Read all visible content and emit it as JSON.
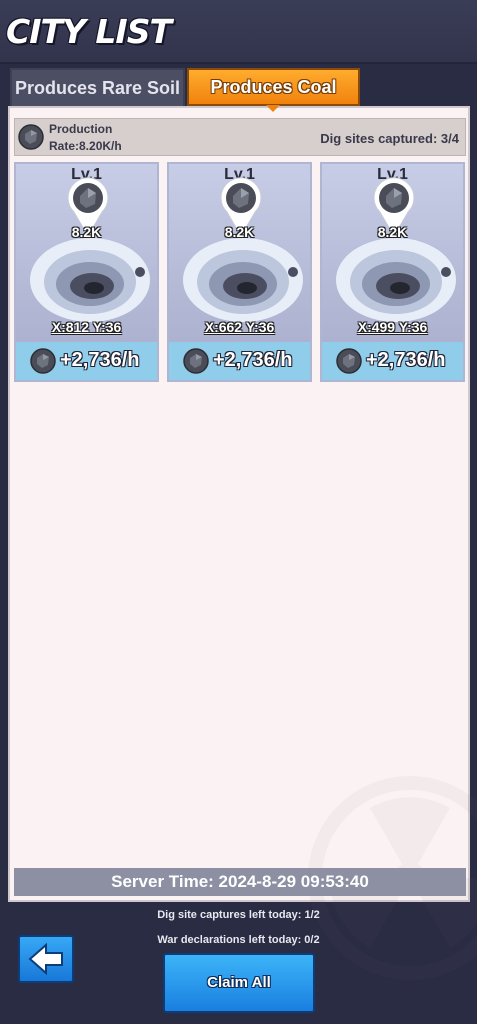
{
  "header": {
    "title": "CITY LIST"
  },
  "tabs": [
    {
      "label": "Produces Rare Soil",
      "active": false
    },
    {
      "label": "Produces Coal",
      "active": true
    }
  ],
  "production": {
    "title": "Production",
    "rate": "Rate:8.20K/h",
    "captured": "Dig sites captured: 3/4",
    "icon": "coal-icon"
  },
  "cards": [
    {
      "level": "Lv.1",
      "amount": "8.2K",
      "coords": "X:812 Y:36",
      "rate": "+2,736/h"
    },
    {
      "level": "Lv.1",
      "amount": "8.2K",
      "coords": "X:662 Y:36",
      "rate": "+2,736/h"
    },
    {
      "level": "Lv.1",
      "amount": "8.2K",
      "coords": "X:499 Y:36",
      "rate": "+2,736/h"
    }
  ],
  "server_time": "Server Time: 2024-8-29 09:53:40",
  "captures_left": "Dig site captures left today: 1/2",
  "war_declarations": "War declarations left today: 0/2",
  "buttons": {
    "back_icon": "arrow-left-icon",
    "claim_all": "Claim All"
  },
  "colors": {
    "active_tab": "#f0820e",
    "card_bg": "#b4bad6",
    "rate_strip": "#8fcdea",
    "button": "#1f8ae6"
  }
}
